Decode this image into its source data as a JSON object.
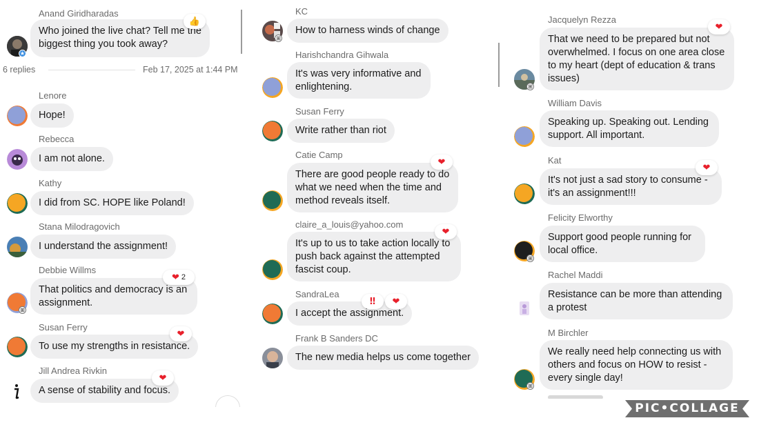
{
  "colors": {
    "bubble": "#eeeeef",
    "text": "#1b1b1b",
    "name": "#6b6b6b",
    "heart": "#e8202b",
    "watermark_bg": "#6f6f6f"
  },
  "left": {
    "header": {
      "author": "Anand Giridharadas",
      "text": "Who joined the live chat? Tell me the biggest thing you took away?",
      "reaction": "👍",
      "replies": "6 replies",
      "date": "Feb 17, 2025 at 1:44 PM"
    },
    "messages": [
      {
        "name": "Lenore",
        "text": "Hope!"
      },
      {
        "name": "Rebecca",
        "text": "I am not alone."
      },
      {
        "name": "Kathy",
        "text": "I did from SC. HOPE like Poland!"
      },
      {
        "name": "Stana Milodragovich",
        "text": "I understand the assignment!"
      },
      {
        "name": "Debbie Willms",
        "text": "That politics and democracy is an assignment.",
        "reaction": "❤",
        "reaction_count": "2"
      },
      {
        "name": "Susan Ferry",
        "text": "To use my strengths in resistance.",
        "reaction": "❤"
      },
      {
        "name": "Jill Andrea Rivkin",
        "text": "A sense of stability and focus.",
        "reaction": "❤"
      }
    ]
  },
  "middle": {
    "messages": [
      {
        "name": "KC",
        "text": "How to harness winds of change"
      },
      {
        "name": "Harishchandra Gihwala",
        "text": "It's was very informative and enlightening."
      },
      {
        "name": "Susan Ferry",
        "text": "Write rather than riot"
      },
      {
        "name": "Catie Camp",
        "text": "There are good people ready to do what we need when the time and method reveals itself.",
        "reaction": "❤"
      },
      {
        "name": "claire_a_louis@yahoo.com",
        "text": "It's up to us to take action locally to push back against the attempted fascist coup.",
        "reaction": "❤"
      },
      {
        "name": "SandraLea",
        "text": "I accept the assignment.",
        "reaction": "❤",
        "reaction_extra": "‼"
      },
      {
        "name": "Frank B Sanders DC",
        "text": "The new media helps us come together"
      }
    ]
  },
  "right": {
    "messages": [
      {
        "name": "Jacquelyn Rezza",
        "text": "That we need to be prepared but not overwhelmed. I focus on one area close to my heart (dept of education & trans issues)",
        "reaction": "❤"
      },
      {
        "name": "William Davis",
        "text": "Speaking up. Speaking out. Lending support. All important."
      },
      {
        "name": "Kat",
        "text": "It's not just a sad story to consume - it's an assignment!!!",
        "reaction": "❤"
      },
      {
        "name": "Felicity Elworthy",
        "text": "Support good people running for local office."
      },
      {
        "name": "Rachel Maddi",
        "text": "Resistance can be more than attending a protest"
      },
      {
        "name": "M Birchler",
        "text": "We really need help connecting us with others and focus on HOW to resist - every single day!"
      }
    ]
  },
  "watermark": "PIC•COLLAGE"
}
